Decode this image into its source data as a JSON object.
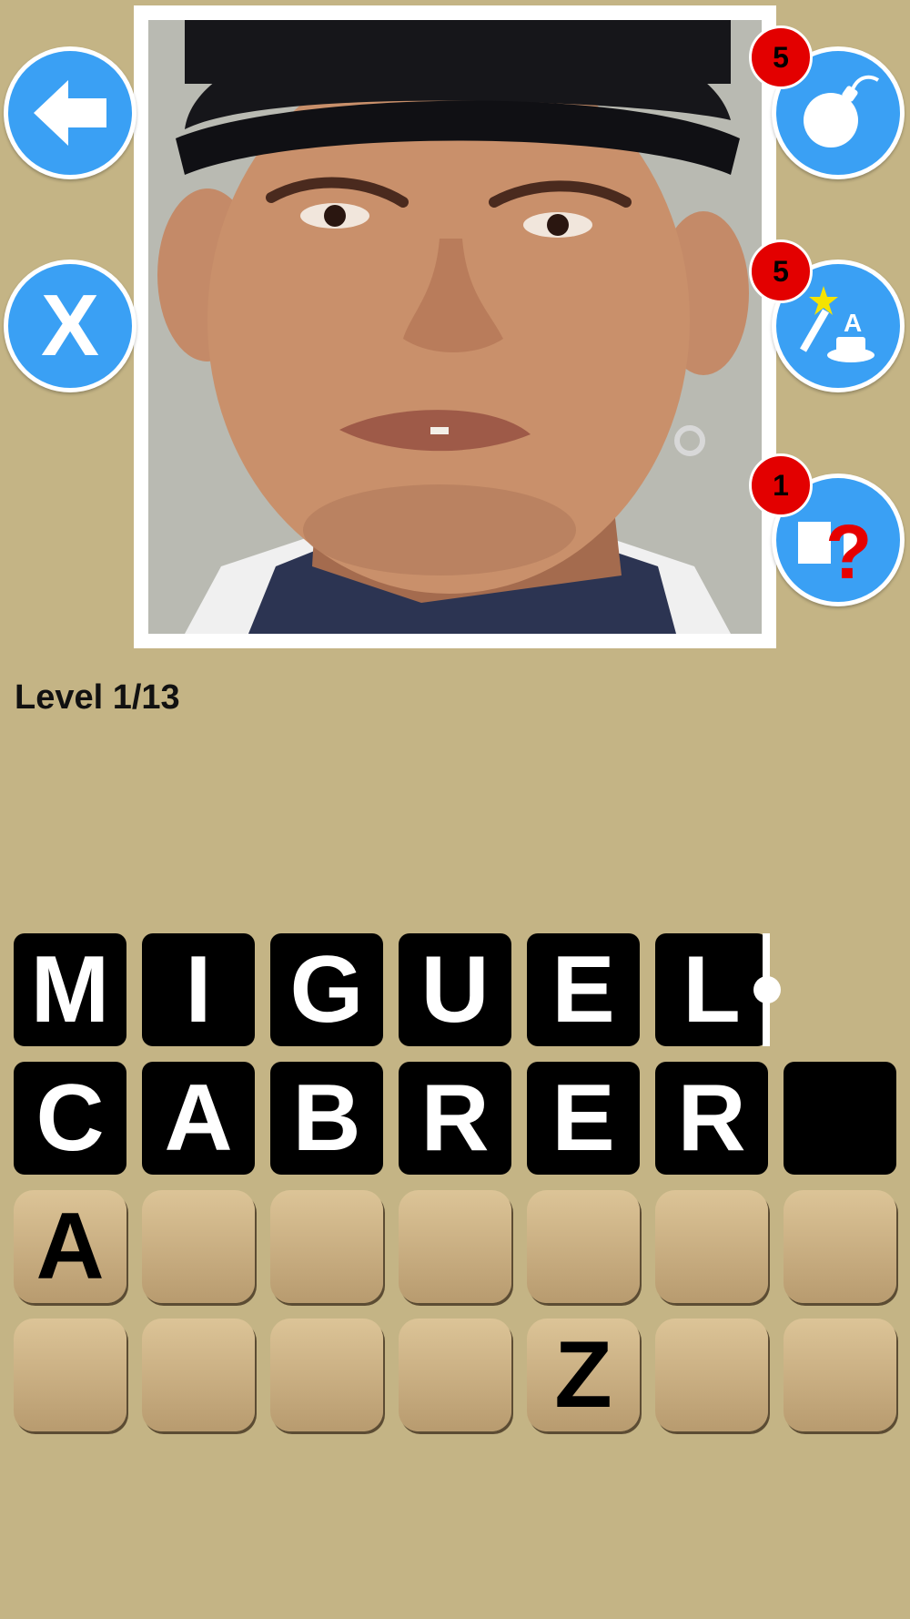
{
  "photo": {
    "alt": "celebrity photo"
  },
  "buttons": {
    "back": {
      "icon": "arrow-left-icon"
    },
    "close": {
      "label": "X"
    },
    "bomb": {
      "icon": "bomb-icon",
      "count": "5"
    },
    "magic": {
      "icon": "magic-wand-hat-icon",
      "count": "5"
    },
    "hint": {
      "icon": "question-card-icon",
      "count": "1"
    }
  },
  "level": {
    "text": "Level 1/13"
  },
  "answer": {
    "row1": [
      "M",
      "I",
      "G",
      "U",
      "E",
      "L"
    ],
    "row2": [
      "C",
      "A",
      "B",
      "R",
      "E",
      "R",
      ""
    ]
  },
  "keyboard": {
    "row1": [
      "A",
      "",
      "",
      "",
      "",
      "",
      ""
    ],
    "row2": [
      "",
      "",
      "",
      "",
      "Z",
      "",
      ""
    ]
  },
  "colors": {
    "background": "#c4b485",
    "button_blue": "#3aa0f4",
    "badge_red": "#e30000",
    "tile_black": "#000000",
    "key_tan": "#c9ae80"
  }
}
